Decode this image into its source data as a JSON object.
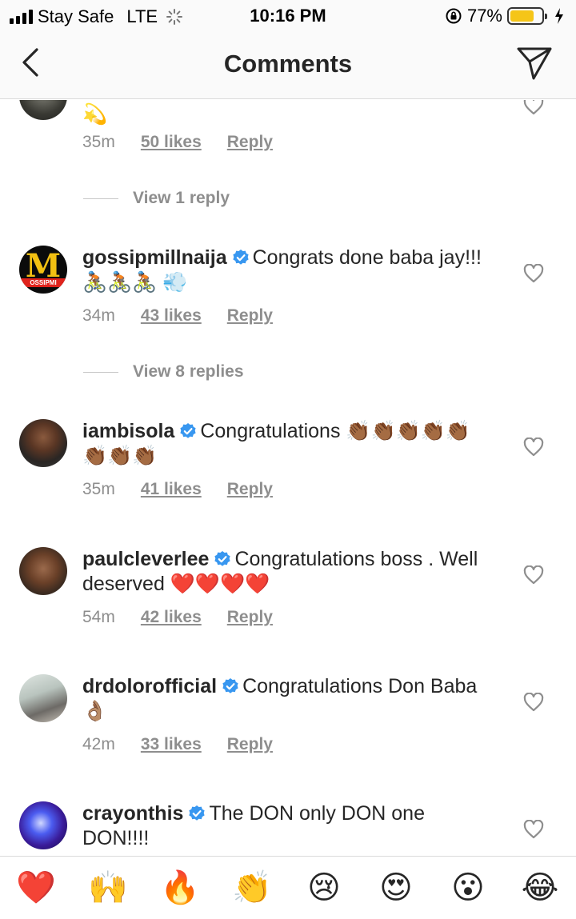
{
  "status_bar": {
    "carrier": "Stay Safe",
    "network": "LTE",
    "time": "10:16 PM",
    "battery": "77%",
    "battery_level": 0.77
  },
  "header": {
    "title": "Comments"
  },
  "comments": [
    {
      "username": "",
      "text": "💫",
      "time": "35m",
      "likes": "50 likes",
      "reply": "Reply",
      "view_replies": "View 1 reply"
    },
    {
      "username": "gossipmillnaija",
      "text": "Congrats done baba jay!!! 🚴🏾🚴🏾🚴🏾 💨",
      "time": "34m",
      "likes": "43 likes",
      "reply": "Reply",
      "view_replies": "View 8 replies",
      "avatar_text": "M",
      "avatar_subtext": "OSSIPMI"
    },
    {
      "username": "iambisola",
      "text": "Congratulations 👏🏾👏🏾👏🏾👏🏾👏🏾👏🏾👏🏾👏🏾",
      "time": "35m",
      "likes": "41 likes",
      "reply": "Reply"
    },
    {
      "username": "paulcleverlee",
      "text": "Congratulations  boss . Well deserved ❤️❤️❤️❤️",
      "time": "54m",
      "likes": "42 likes",
      "reply": "Reply"
    },
    {
      "username": "drdolorofficial",
      "text": "Congratulations Don Baba 👌🏽",
      "time": "42m",
      "likes": "33 likes",
      "reply": "Reply"
    },
    {
      "username": "crayonthis",
      "text": "The DON only DON one DON!!!!"
    }
  ],
  "emoji_bar": [
    "❤️",
    "🙌",
    "🔥",
    "👏",
    "😢",
    "😍",
    "😮",
    "😂"
  ],
  "colors": {
    "verified": "#3897f0",
    "meta": "#8e8e8e",
    "text": "#262626",
    "battery": "#f5c518"
  }
}
